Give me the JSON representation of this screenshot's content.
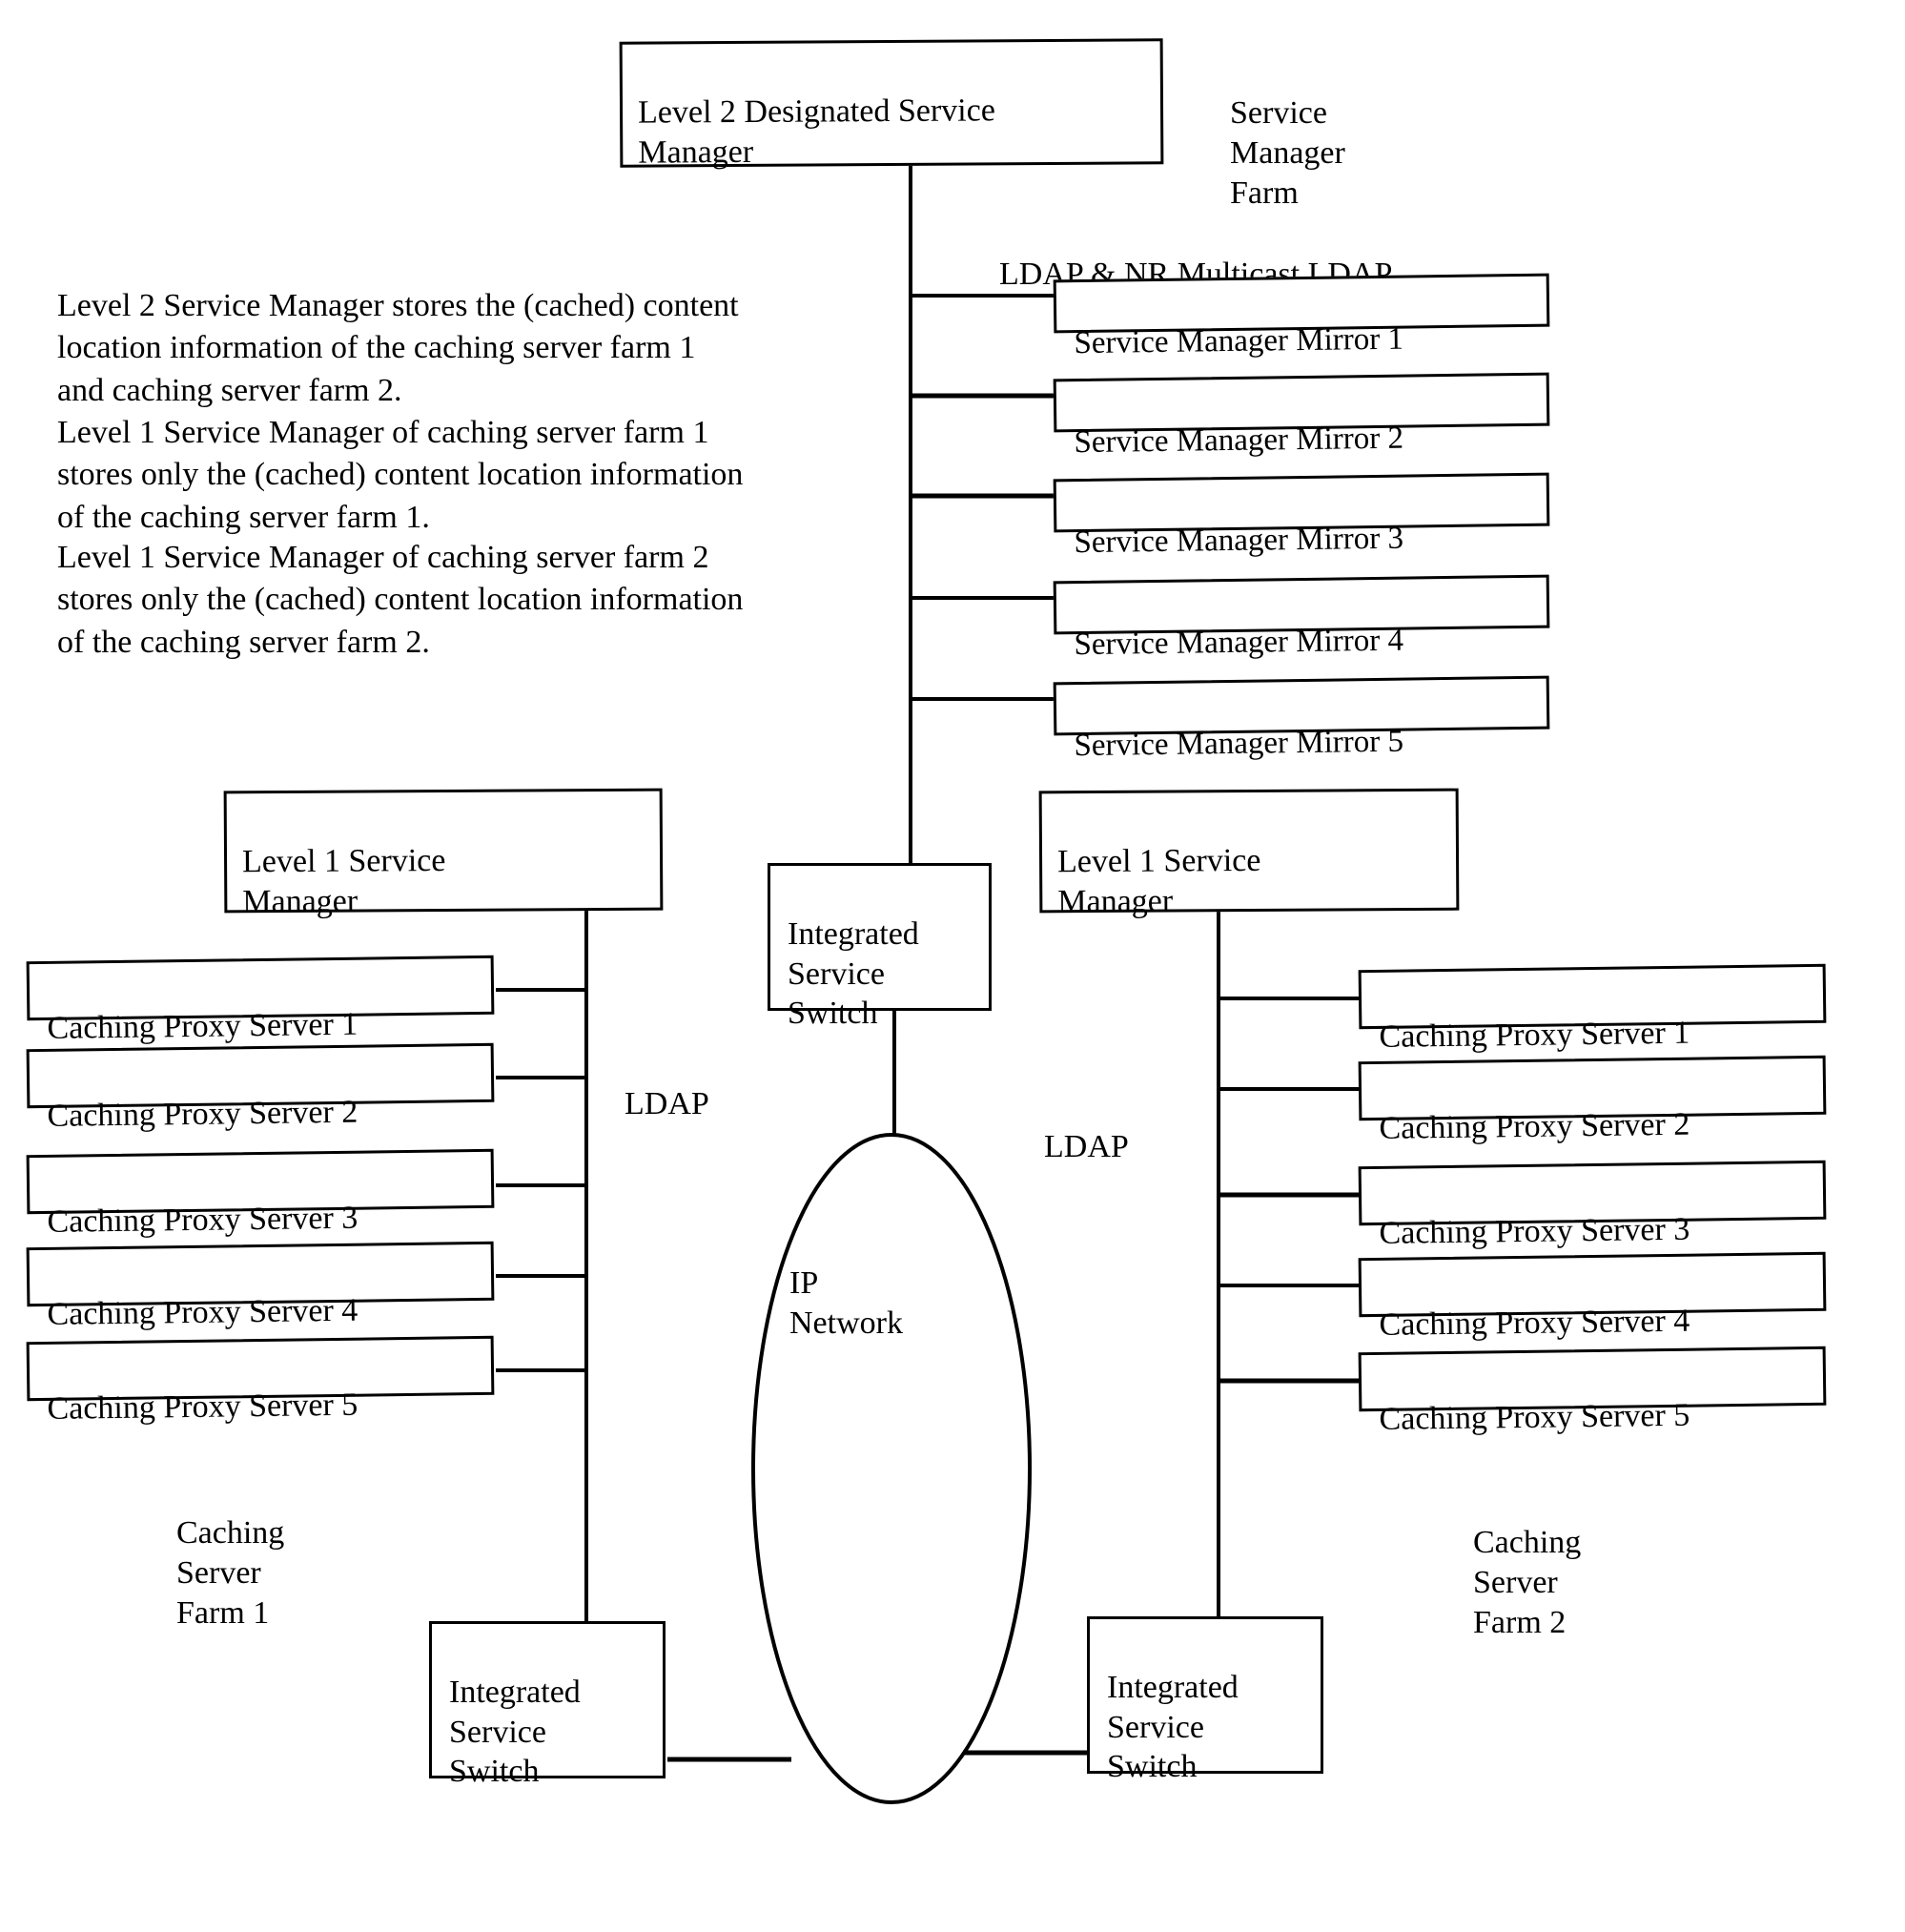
{
  "diagram": {
    "title_box": {
      "label": "Level 2 Designated Service\nManager"
    },
    "farm_label": {
      "label": "Service\nManager\nFarm"
    },
    "ldap_nr_label": {
      "label": "LDAP & NR Multicast LDAP"
    },
    "description": {
      "paragraphs": [
        "Level 2 Service Manager stores the (cached) content\nlocation information of the caching server farm 1\nand caching server farm 2.",
        "Level 1 Service Manager of caching server farm 1\nstores only the (cached) content location information\nof the caching server farm 1.",
        "Level 1 Service Manager of caching server farm 2\nstores only the (cached) content location information\nof the caching server farm 2."
      ]
    },
    "mirrors": [
      {
        "label": "Service Manager Mirror 1"
      },
      {
        "label": "Service Manager Mirror 2"
      },
      {
        "label": "Service Manager Mirror 3"
      },
      {
        "label": "Service Manager Mirror 4"
      },
      {
        "label": "Service Manager Mirror 5"
      }
    ],
    "level1_left": {
      "label": "Level 1 Service\nManager"
    },
    "level1_right": {
      "label": "Level 1 Service\nManager"
    },
    "switch_center": {
      "label": "Integrated\nService\nSwitch"
    },
    "switch_bottom_left": {
      "label": "Integrated\nService\nSwitch"
    },
    "switch_bottom_right": {
      "label": "Integrated\nService\nSwitch"
    },
    "ip_network": {
      "label": "IP\nNetwork"
    },
    "ldap_left": {
      "label": "LDAP"
    },
    "ldap_right": {
      "label": "LDAP"
    },
    "farm1_label": {
      "label": "Caching\nServer\nFarm 1"
    },
    "farm2_label": {
      "label": "Caching\nServer\nFarm 2"
    },
    "proxies_left": [
      {
        "label": "Caching Proxy Server 1"
      },
      {
        "label": "Caching Proxy Server 2"
      },
      {
        "label": "Caching Proxy Server 3"
      },
      {
        "label": "Caching Proxy Server 4"
      },
      {
        "label": "Caching Proxy Server 5"
      }
    ],
    "proxies_right": [
      {
        "label": "Caching Proxy Server 1"
      },
      {
        "label": "Caching Proxy Server 2"
      },
      {
        "label": "Caching Proxy Server 3"
      },
      {
        "label": "Caching Proxy Server 4"
      },
      {
        "label": "Caching Proxy Server 5"
      }
    ],
    "colors": {
      "line": "#000000",
      "background": "#ffffff"
    }
  }
}
